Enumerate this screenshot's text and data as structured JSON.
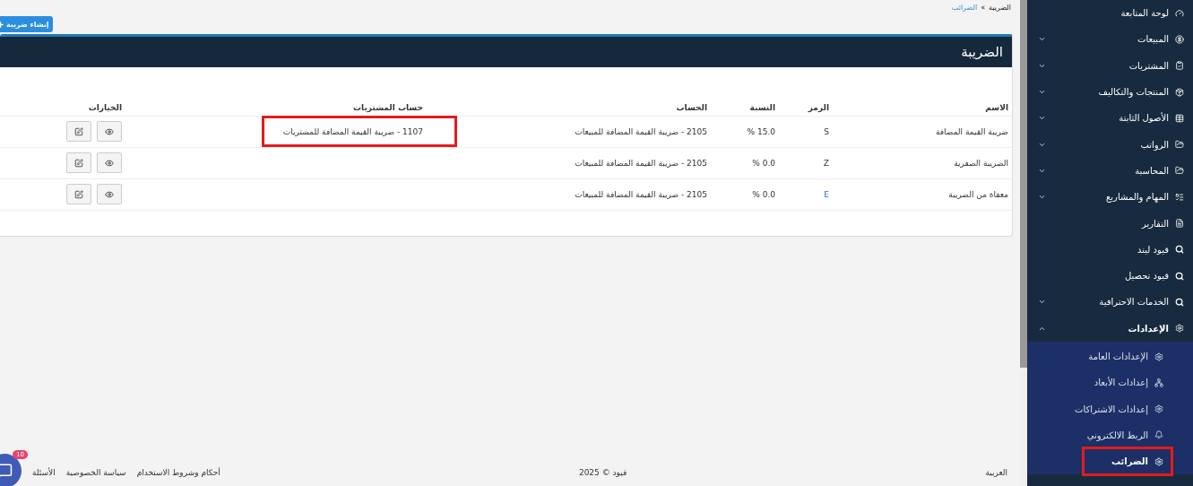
{
  "breadcrumb": {
    "parent": "الضرائب",
    "separator": "»",
    "current": "الضريبة"
  },
  "create_button": {
    "label": "إنشاء ضريبة"
  },
  "card": {
    "title": "الضريبة"
  },
  "table": {
    "columns": [
      "الاسم",
      "الرمز",
      "النسبة",
      "الحساب",
      "حساب المشتريات",
      "الخيارات"
    ],
    "rows": [
      {
        "name": "ضريبة القيمة المضافة",
        "symbol": "S",
        "rate": "15.0 %",
        "account": "2105 - ضريبة القيمة المضافة للمبيعات",
        "purchase_account": "1107 - ضريبة القيمة المضافة للمشتريات",
        "highlighted": true
      },
      {
        "name": "الضريبة الصفرية",
        "symbol": "Z",
        "rate": "0.0 %",
        "account": "2105 - ضريبة القيمة المضافة للمبيعات",
        "highlighted": false
      },
      {
        "name": "معفاة من الضريبة",
        "symbol": "E",
        "rate": "0.0 %",
        "account": "2105 - ضريبة القيمة المضافة للمبيعات",
        "highlighted": false
      }
    ]
  },
  "footer": {
    "language": "العربية",
    "copyright": "قيود © 2025",
    "links": [
      "أحكام وشروط الاستخدام",
      "سياسة الخصوصية",
      "الأسئلة"
    ],
    "chat_badge": "10"
  },
  "sidebar": {
    "items": [
      {
        "label": "لوحة المتابعة"
      },
      {
        "label": "المبيعات",
        "expanded": false
      },
      {
        "label": "المشتريات",
        "expanded": false
      },
      {
        "label": "المنتجات والتكاليف",
        "expanded": false
      },
      {
        "label": "الأصول الثابتة",
        "expanded": false
      },
      {
        "label": "الرواتب",
        "expanded": false
      },
      {
        "label": "المحاسبة",
        "expanded": false
      },
      {
        "label": "المهام والمشاريع",
        "expanded": false
      },
      {
        "label": "التقارير"
      },
      {
        "label": "قيود ليند"
      },
      {
        "label": "قيود تحصيل"
      },
      {
        "label": "الخدمات الاحترافية",
        "expanded": false
      },
      {
        "label": "الإعدادات",
        "expanded": true,
        "children": [
          {
            "label": "الإعدادات العامة",
            "selected": false
          },
          {
            "label": "إعدادات الأبعاد",
            "selected": false
          },
          {
            "label": "إعدادات الاشتراكات",
            "selected": false
          },
          {
            "label": "الربط الالكتروني",
            "selected": false
          },
          {
            "label": "الضرائب",
            "selected": true
          }
        ]
      }
    ]
  }
}
